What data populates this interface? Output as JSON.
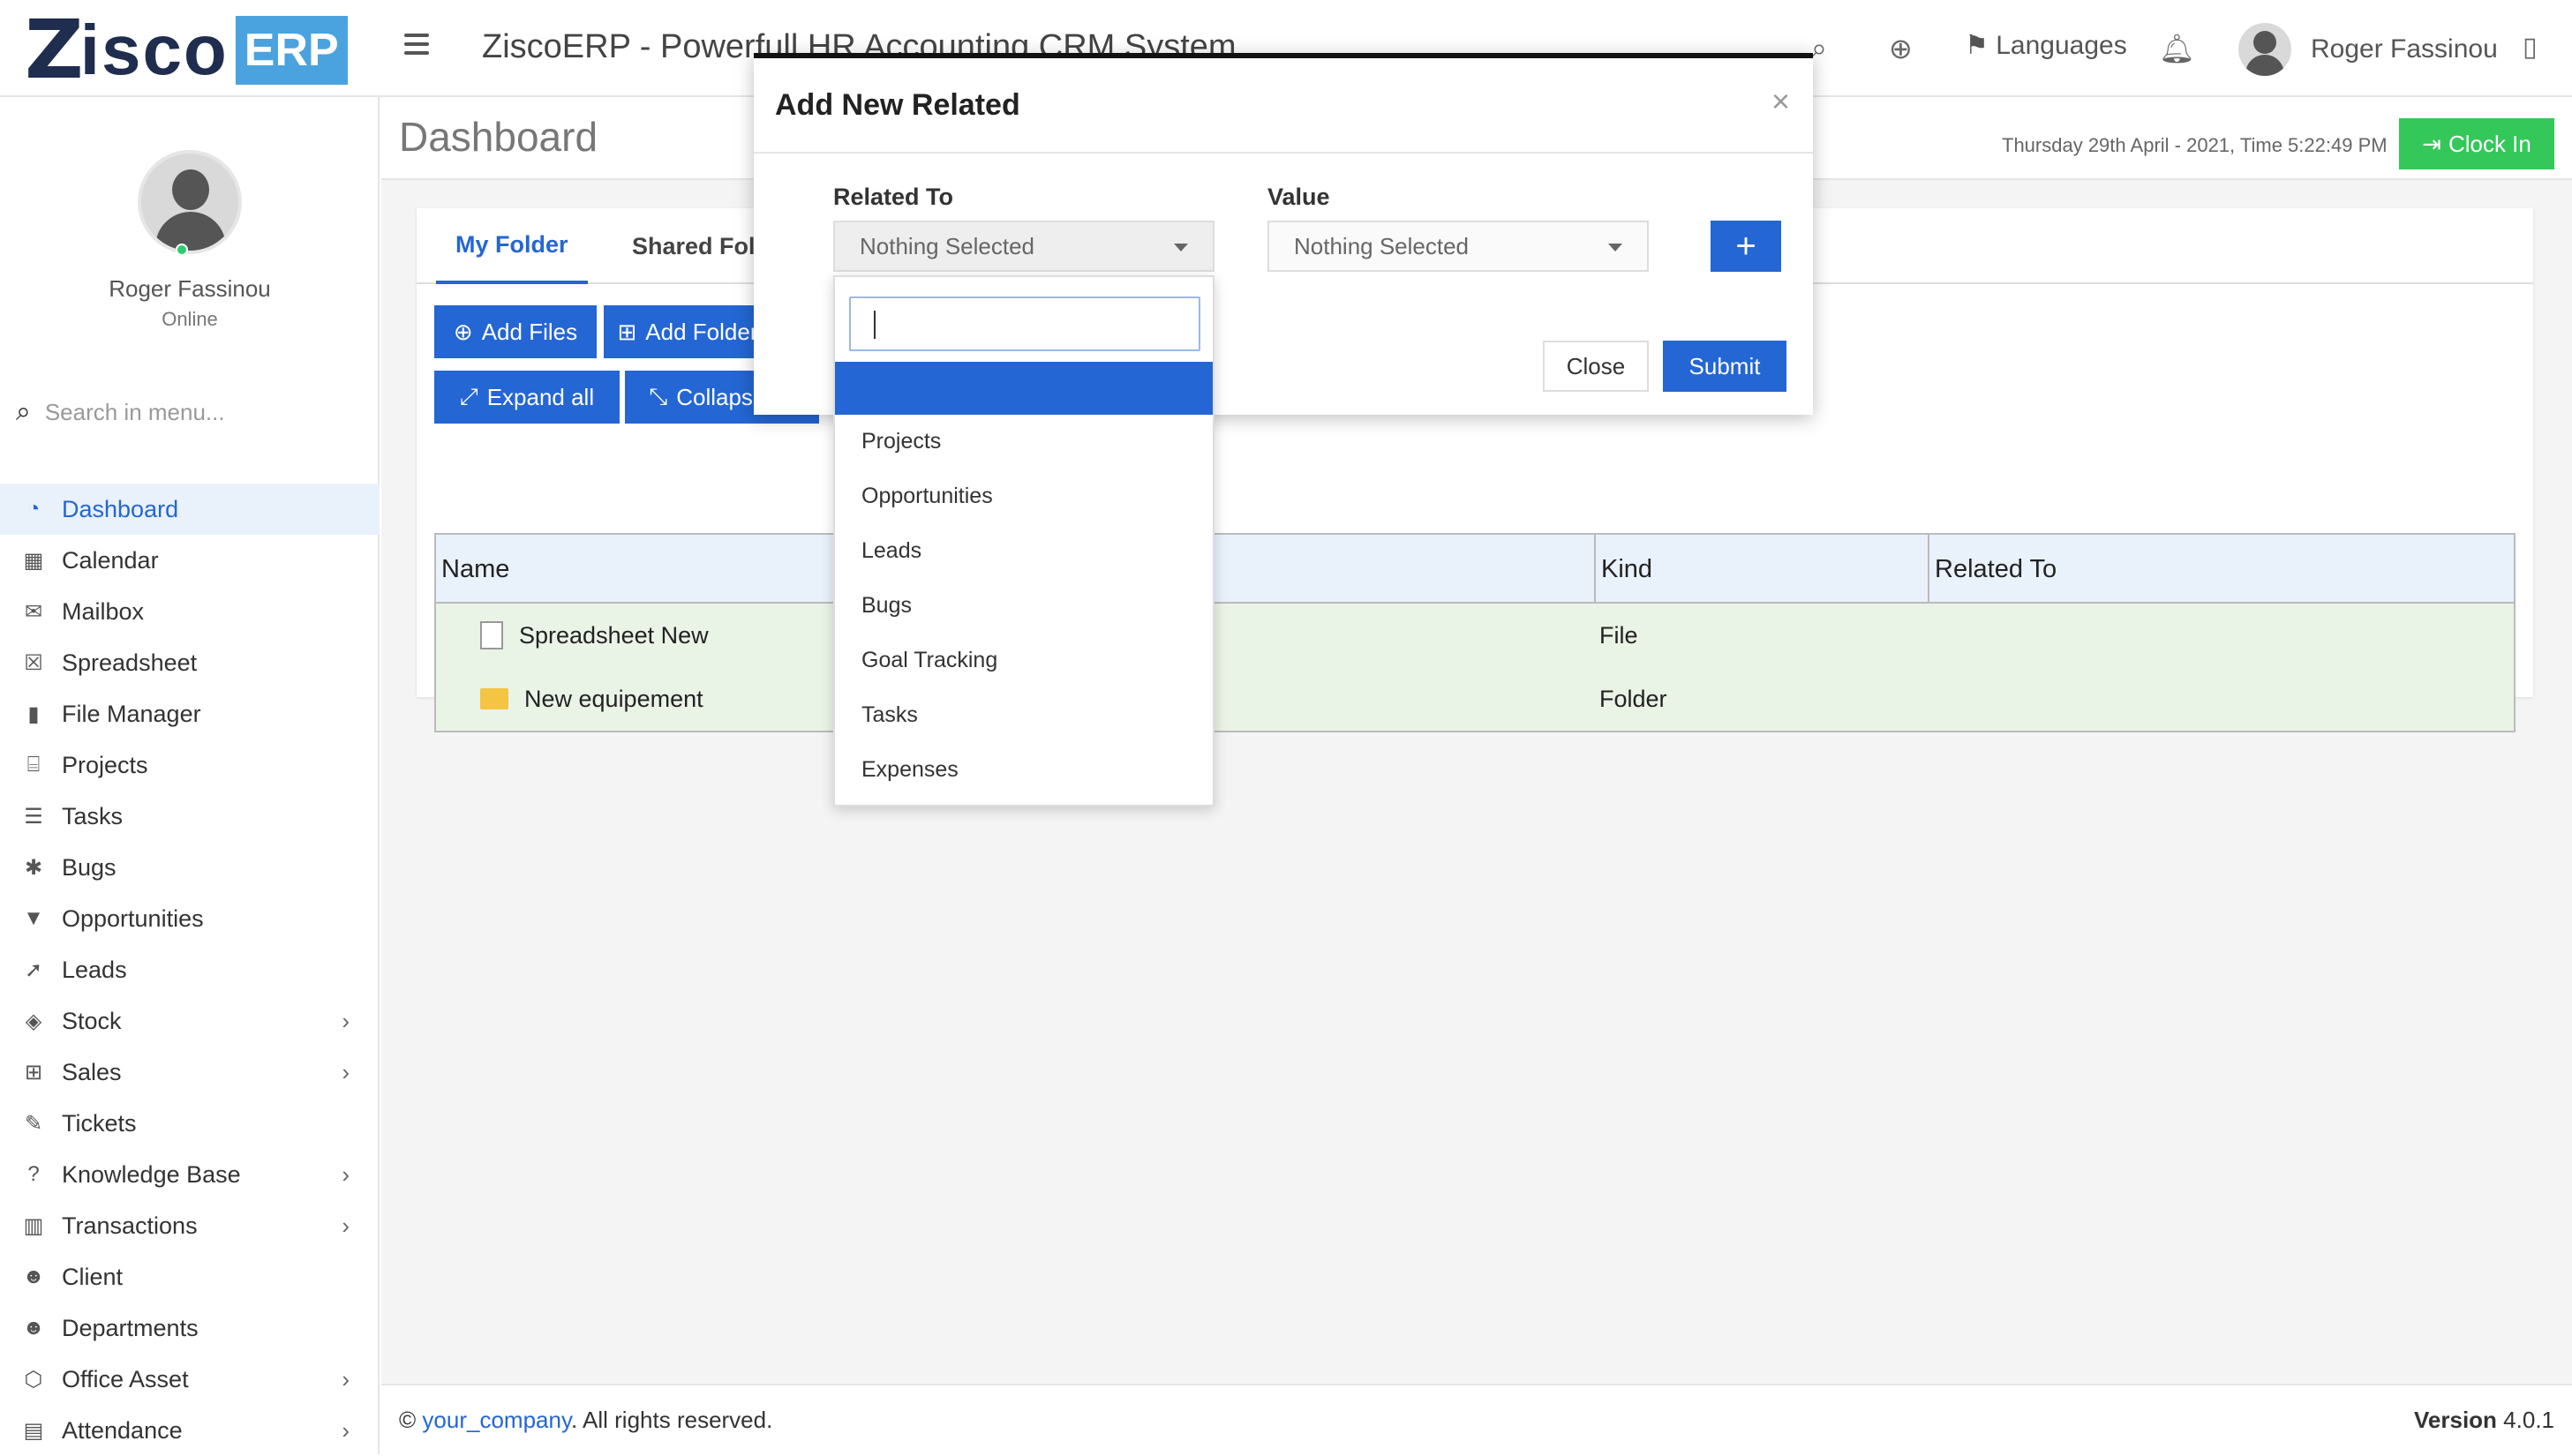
{
  "topbar": {
    "logo_mark": "Z",
    "logo_text": "isco",
    "logo_badge": "ERP",
    "title": "ZiscoERP - Powerfull HR Accounting CRM System",
    "languages_label": "Languages",
    "user_name": "Roger Fassinou"
  },
  "sidebar": {
    "profile_name": "Roger Fassinou",
    "profile_status": "Online",
    "search_placeholder": "Search in menu...",
    "items": [
      {
        "label": "Dashboard",
        "icon": "dashboard-icon",
        "glyph": "◔",
        "active": true,
        "has_children": false
      },
      {
        "label": "Calendar",
        "icon": "calendar-icon",
        "glyph": "▦",
        "has_children": false
      },
      {
        "label": "Mailbox",
        "icon": "envelope-icon",
        "glyph": "✉",
        "has_children": false
      },
      {
        "label": "Spreadsheet",
        "icon": "spreadsheet-icon",
        "glyph": "☒",
        "has_children": false
      },
      {
        "label": "File Manager",
        "icon": "file-icon",
        "glyph": "▮",
        "has_children": false
      },
      {
        "label": "Projects",
        "icon": "folder-open-icon",
        "glyph": "⌸",
        "has_children": false
      },
      {
        "label": "Tasks",
        "icon": "tasks-icon",
        "glyph": "☰",
        "has_children": false
      },
      {
        "label": "Bugs",
        "icon": "bug-icon",
        "glyph": "✱",
        "has_children": false
      },
      {
        "label": "Opportunities",
        "icon": "filter-icon",
        "glyph": "▼",
        "has_children": false
      },
      {
        "label": "Leads",
        "icon": "rocket-icon",
        "glyph": "➚",
        "has_children": false
      },
      {
        "label": "Stock",
        "icon": "layers-icon",
        "glyph": "◈",
        "has_children": true
      },
      {
        "label": "Sales",
        "icon": "cart-icon",
        "glyph": "⊞",
        "has_children": true
      },
      {
        "label": "Tickets",
        "icon": "ticket-icon",
        "glyph": "✎",
        "has_children": false
      },
      {
        "label": "Knowledge Base",
        "icon": "question-icon",
        "glyph": "?",
        "has_children": true
      },
      {
        "label": "Transactions",
        "icon": "building-icon",
        "glyph": "▥",
        "has_children": true
      },
      {
        "label": "Client",
        "icon": "users-icon",
        "glyph": "☻",
        "has_children": false
      },
      {
        "label": "Departments",
        "icon": "group-icon",
        "glyph": "☻",
        "has_children": false
      },
      {
        "label": "Office Asset",
        "icon": "cube-icon",
        "glyph": "⬡",
        "has_children": true
      },
      {
        "label": "Attendance",
        "icon": "attendance-icon",
        "glyph": "▤",
        "has_children": true
      }
    ]
  },
  "page": {
    "title": "Dashboard",
    "datetime": "Thursday 29th April - 2021,  Time   5:22:49 PM",
    "clock_in_label": "Clock In"
  },
  "file_manager": {
    "tabs": [
      "My Folder",
      "Shared Folder"
    ],
    "add_files_label": "Add Files",
    "add_folder_label": "Add Folder",
    "expand_all_label": "Expand all",
    "collapse_all_label": "Collapse all",
    "columns": [
      "Name",
      "Kind",
      "Related To"
    ],
    "rows": [
      {
        "name": "Spreadsheet New",
        "kind": "File",
        "related_to": "",
        "icon": "file-icon"
      },
      {
        "name": "New equipement",
        "kind": "Folder",
        "related_to": "",
        "icon": "folder-icon"
      }
    ]
  },
  "modal": {
    "title": "Add New Related",
    "related_to_label": "Related To",
    "related_to_value": "Nothing Selected",
    "value_label": "Value",
    "value_value": "Nothing Selected",
    "close_label": "Close",
    "submit_label": "Submit",
    "dropdown_options": [
      "Projects",
      "Opportunities",
      "Leads",
      "Bugs",
      "Goal Tracking",
      "Tasks",
      "Expenses"
    ]
  },
  "footer": {
    "copyright_symbol": "©",
    "company_link": "your_company",
    "rights_text": ". All rights reserved.",
    "version_label": "Version",
    "version_value": "4.0.1"
  },
  "colors": {
    "primary": "#2466d4",
    "success": "#34c759",
    "table_header": "#e9f1fb",
    "table_body": "#e9f3e6"
  }
}
